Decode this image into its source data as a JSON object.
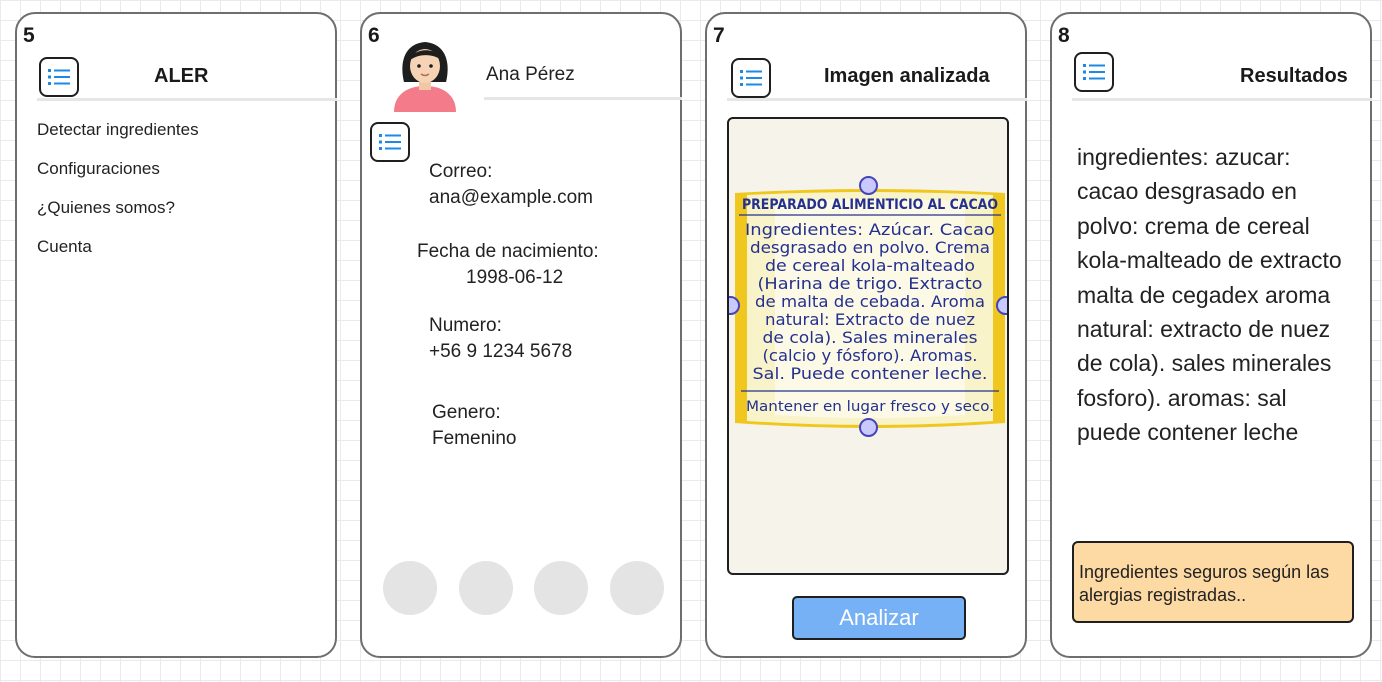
{
  "screens": {
    "s5": {
      "number": "5",
      "title": "ALER",
      "menu_items": [
        "Detectar ingredientes",
        "Configuraciones",
        "¿Quienes somos?",
        "Cuenta"
      ]
    },
    "s6": {
      "number": "6",
      "name": "Ana Pérez",
      "email_label": "Correo:",
      "email": "ana@example.com",
      "birth_label": "Fecha de nacimiento:",
      "birth": "1998-06-12",
      "phone_label": "Numero:",
      "phone": "+56 9 1234 5678",
      "gender_label": "Genero:",
      "gender": "Femenino"
    },
    "s7": {
      "number": "7",
      "title": "Imagen analizada",
      "analyze_label": "Analizar",
      "photo_text": {
        "line1": "PREPARADO ALIMENTICIO AL CACAO",
        "line2": "Ingredientes: Azúcar. Cacao",
        "line3": "desgrasado en polvo. Crema",
        "line4": "de cereal kola-malteado",
        "line5": "(Harina de trigo. Extracto",
        "line6": "de malta de cebada. Aroma",
        "line7": "natural: Extracto de nuez",
        "line8": "de cola). Sales minerales",
        "line9": "(calcio y fósforo). Aromas.",
        "line10": "Sal. Puede contener leche.",
        "line11": "Mantener en lugar fresco y seco."
      }
    },
    "s8": {
      "number": "8",
      "title": "Resultados",
      "results_text": "ingredientes: azucar: cacao desgrasado en polvo: crema de cereal kola-malteado de extracto malta de cegadex aroma natural: extracto de nuez de cola). sales minerales fosforo). aromas: sal puede contener leche",
      "note": "Ingredientes seguros según las alergias registradas.."
    }
  },
  "colors": {
    "accent_blue": "#1e88e5",
    "button_blue": "#76b1f5",
    "note_bg": "#fdd9a4",
    "handle_fill": "#c9c9ff",
    "label_yellow": "#f0c71e",
    "label_text": "#24308f"
  }
}
